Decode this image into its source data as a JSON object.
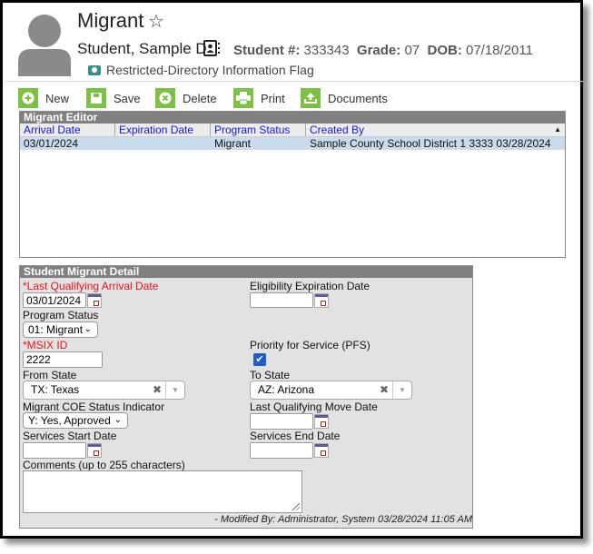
{
  "header": {
    "title": "Migrant",
    "student_name": "Student, Sample D",
    "student_number_label": "Student #:",
    "student_number": "333343",
    "grade_label": "Grade:",
    "grade": "07",
    "dob_label": "DOB:",
    "dob": "07/18/2011",
    "flag": "Restricted-Directory Information Flag"
  },
  "toolbar": {
    "new_label": "New",
    "save_label": "Save",
    "delete_label": "Delete",
    "print_label": "Print",
    "documents_label": "Documents"
  },
  "editor": {
    "title": "Migrant Editor",
    "columns": [
      "Arrival Date",
      "Expiration Date",
      "Program Status",
      "Created By"
    ],
    "rows": [
      [
        "03/01/2024",
        "",
        "Migrant",
        "Sample County School District 1 3333 03/28/2024"
      ]
    ]
  },
  "detail": {
    "title": "Student Migrant Detail",
    "last_arrival_label": "*Last Qualifying Arrival Date",
    "last_arrival_value": "03/01/2024",
    "eligibility_exp_label": "Eligibility Expiration Date",
    "eligibility_exp_value": "",
    "program_status_label": "Program Status",
    "program_status_value": "01: Migrant",
    "msix_label": "*MSIX ID",
    "msix_value": "2222",
    "pfs_label": "Priority for Service (PFS)",
    "pfs_checked": true,
    "from_state_label": "From State",
    "from_state_value": "TX: Texas",
    "to_state_label": "To State",
    "to_state_value": "AZ: Arizona",
    "coe_label": "Migrant COE Status Indicator",
    "coe_value": "Y: Yes, Approved",
    "last_move_label": "Last Qualifying Move Date",
    "last_move_value": "",
    "services_start_label": "Services Start Date",
    "services_start_value": "",
    "services_end_label": "Services End Date",
    "services_end_value": "",
    "comments_label": "Comments (up to 255 characters)",
    "comments_value": "",
    "modified": "- Modified By: Administrator, System 03/28/2024 11:05 AM"
  },
  "colors": {
    "toolbar_green": "#7cc242",
    "panel_header": "#808080",
    "required_red": "#e8121c",
    "link_blue": "#1515e8",
    "selected_row": "#c8dcee"
  }
}
